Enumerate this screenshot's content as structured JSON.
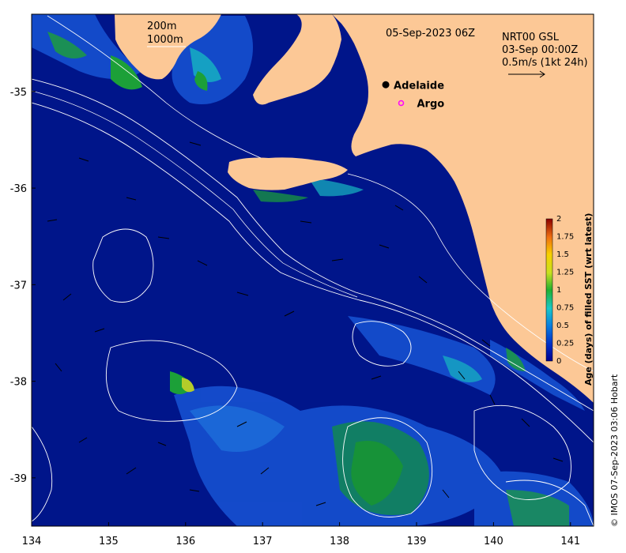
{
  "map": {
    "date_label": "05-Sep-2023 06Z",
    "depth_labels": [
      "200m",
      "1000m"
    ],
    "current_source": [
      "NRT00 GSL",
      "03-Sep 00:00Z",
      "0.5m/s (1kt 24h)"
    ],
    "places": [
      {
        "name": "Adelaide",
        "lon": 138.6,
        "lat": -34.93,
        "marker": "dot",
        "marker_color": "#000000"
      },
      {
        "name": "Argo",
        "lon": 138.8,
        "lat": -35.12,
        "marker": "ring",
        "marker_color": "#ff00ff"
      }
    ],
    "credit": "© IMOS 07-Sep-2023 03:06 Hobart",
    "x_ticks": [
      "134",
      "135",
      "136",
      "137",
      "138",
      "139",
      "140",
      "141"
    ],
    "x_tick_values": [
      134,
      135,
      136,
      137,
      138,
      139,
      140,
      141
    ],
    "y_ticks": [
      "-35",
      "-36",
      "-37",
      "-38",
      "-39"
    ],
    "y_tick_values": [
      -35,
      -36,
      -37,
      -38,
      -39
    ],
    "lon_range": [
      134,
      141.3
    ],
    "lat_range": [
      -39.5,
      -34.2
    ]
  },
  "colorbar": {
    "label": "Age (days) of filled SST (wrt latest)",
    "ticks": [
      "0",
      "0.25",
      "0.5",
      "0.75",
      "1",
      "1.25",
      "1.5",
      "1.75",
      "2"
    ],
    "tick_values": [
      0,
      0.25,
      0.5,
      0.75,
      1,
      1.25,
      1.5,
      1.75,
      2
    ],
    "range": [
      0,
      2
    ]
  },
  "colors": {
    "ocean": "#00158a",
    "land": "#fcc896",
    "contour": "#ffffff"
  }
}
